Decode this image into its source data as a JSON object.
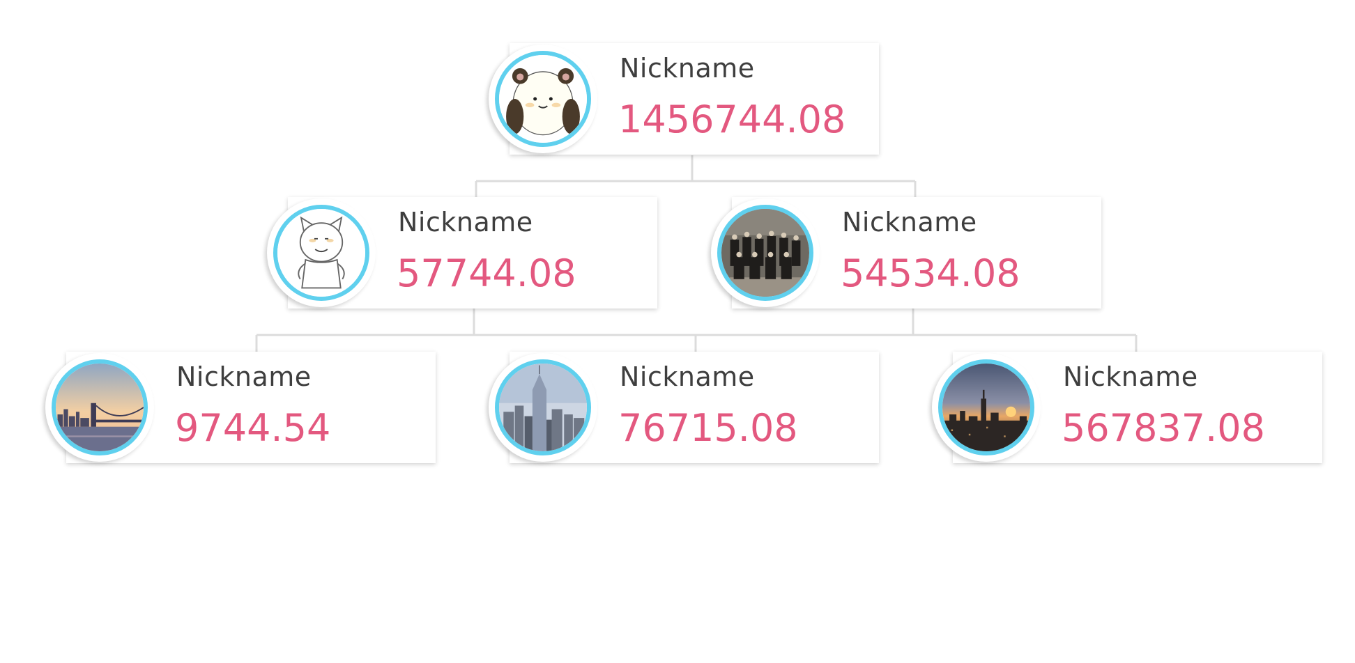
{
  "theme": {
    "avatar_ring": "#5fd0ee",
    "amount_color": "#e3587f",
    "name_color": "#3e3e3e",
    "connector_color": "#dcdcdc"
  },
  "nodes": [
    {
      "id": "root",
      "nickname": "Nickname",
      "amount": "1456744.08",
      "avatar_icon": "panda-cartoon-avatar"
    },
    {
      "id": "l1-left",
      "nickname": "Nickname",
      "amount": "57744.08",
      "avatar_icon": "cartoon-character-sketch-avatar"
    },
    {
      "id": "l1-right",
      "nickname": "Nickname",
      "amount": "54534.08",
      "avatar_icon": "group-photo-avatar"
    },
    {
      "id": "l2-a",
      "nickname": "Nickname",
      "amount": "9744.54",
      "avatar_icon": "bridge-skyline-avatar"
    },
    {
      "id": "l2-b",
      "nickname": "Nickname",
      "amount": "76715.08",
      "avatar_icon": "skyscraper-city-avatar"
    },
    {
      "id": "l2-c",
      "nickname": "Nickname",
      "amount": "567837.08",
      "avatar_icon": "sunset-city-avatar"
    }
  ]
}
